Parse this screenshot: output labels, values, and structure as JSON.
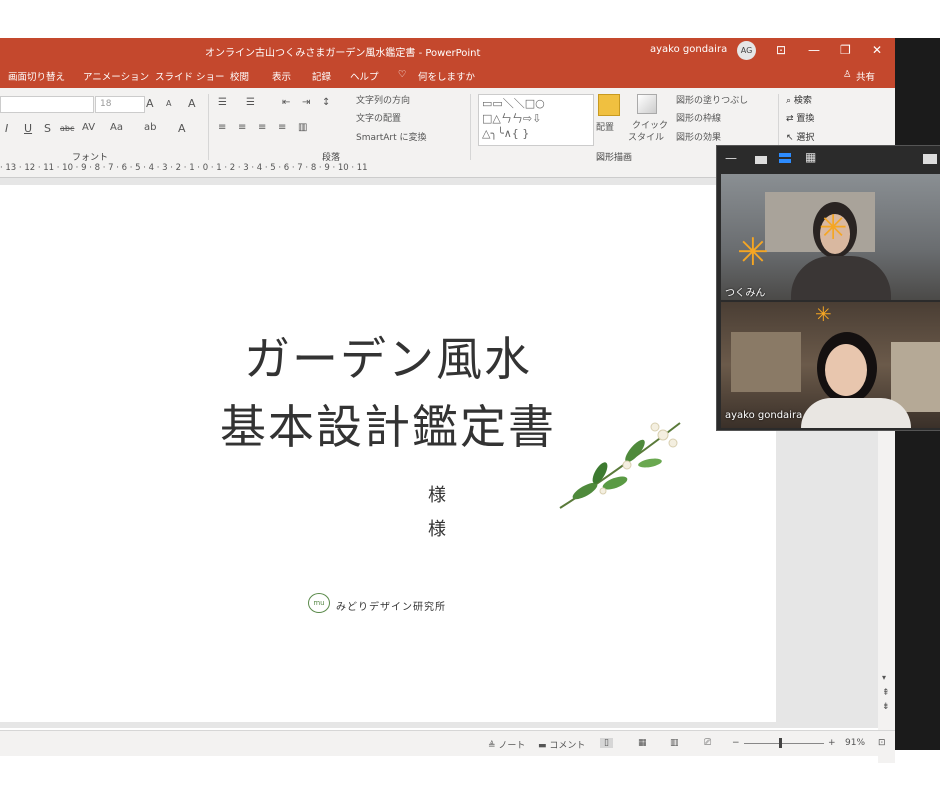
{
  "window": {
    "title": "オンライン古山つくみさまガーデン風水鑑定書 - PowerPoint",
    "user_name": "ayako gondaira",
    "user_initials": "AG",
    "controls": {
      "ribbon_opts": "⊡",
      "minimize": "—",
      "restore": "❐",
      "close": "✕"
    }
  },
  "menu": {
    "tabs": [
      "画面切り替え",
      "アニメーション",
      "スライド ショー",
      "校閲",
      "表示",
      "記録",
      "ヘルプ",
      "何をしますか"
    ],
    "share": "共有"
  },
  "ribbon": {
    "font_size": "18",
    "font_group": "フォント",
    "paragraph_group": "段落",
    "drawing_group": "図形描画",
    "text_direction": "文字列の方向",
    "align_text": "文字の配置",
    "smartart": "SmartArt に変換",
    "arrange": "配置",
    "quick_style_1": "クイック",
    "quick_style_2": "スタイル",
    "shape_fill": "図形の塗りつぶし",
    "shape_outline": "図形の枠線",
    "shape_effects": "図形の効果",
    "search": "検索",
    "replace": "置換",
    "select": "選択"
  },
  "ruler": {
    "ticks": "· 13 · 12 · 11 · 10 · 9 · 8 · 7 · 6 · 5 · 4 · 3 · 2 · 1 · 0 · 1 · 2 · 3 · 4 · 5 · 6 · 7 · 8 · 9 · 10 · 11"
  },
  "slide": {
    "title_line1": "ガーデン風水",
    "title_line2": "基本設計鑑定書",
    "sama_1": "様",
    "sama_2": "様",
    "logo_mark": "mu",
    "logo_text": "みどりデザイン研究所"
  },
  "statusbar": {
    "notes": "ノート",
    "comments": "コメント",
    "zoom": "91%"
  },
  "video": {
    "participant_1": "つくみん",
    "participant_2": "ayako gondaira"
  },
  "colors": {
    "accent": "#c4482d",
    "leaf": "#5a8a4a",
    "star": "#f5a623"
  }
}
